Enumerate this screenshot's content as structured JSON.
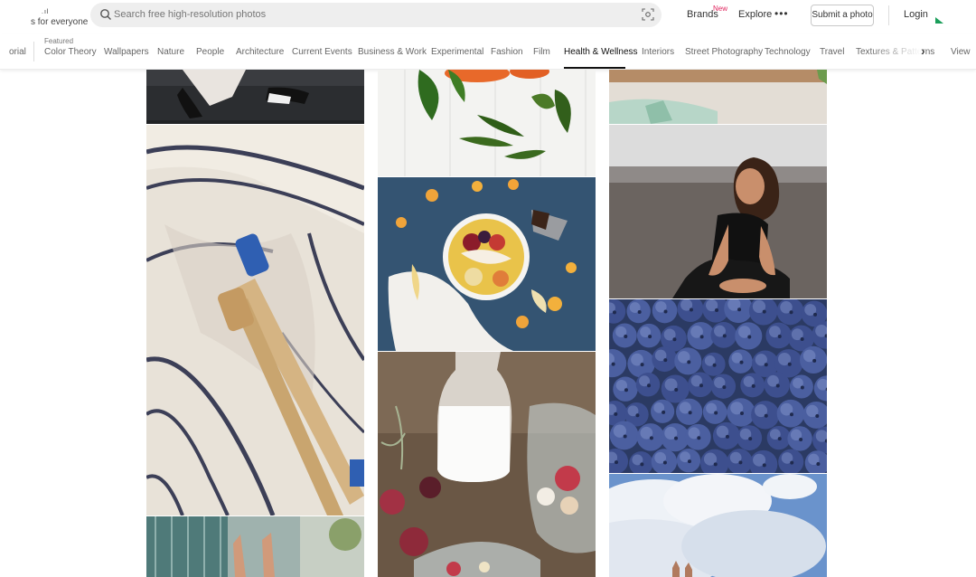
{
  "header": {
    "logo_tagline": "s for everyone",
    "search_placeholder": "Search free high-resolution photos",
    "brands_label": "Brands",
    "brands_badge": "New",
    "explore_label": "Explore",
    "more_label": "•••",
    "submit_label": "Submit a photo",
    "login_label": "Login"
  },
  "nav": {
    "featured_label": "Featured",
    "active": "Health & Wellness",
    "items": [
      "orial",
      "Color Theory",
      "Wallpapers",
      "Nature",
      "People",
      "Architecture",
      "Current Events",
      "Business & Work",
      "Experimental",
      "Fashion",
      "Film",
      "Health & Wellness",
      "Interiors",
      "Street Photography",
      "Technology",
      "Travel",
      "Textures & Patterns",
      "View"
    ]
  },
  "photos": [
    {
      "name": "photo-legs-workout"
    },
    {
      "name": "photo-bamboo-toothbrushes"
    },
    {
      "name": "photo-building-hands"
    },
    {
      "name": "photo-green-leaves"
    },
    {
      "name": "photo-fruit-bowl"
    },
    {
      "name": "photo-milk-bottle"
    },
    {
      "name": "photo-woman-smiling"
    },
    {
      "name": "photo-blueberries"
    },
    {
      "name": "photo-sky-clouds"
    }
  ]
}
